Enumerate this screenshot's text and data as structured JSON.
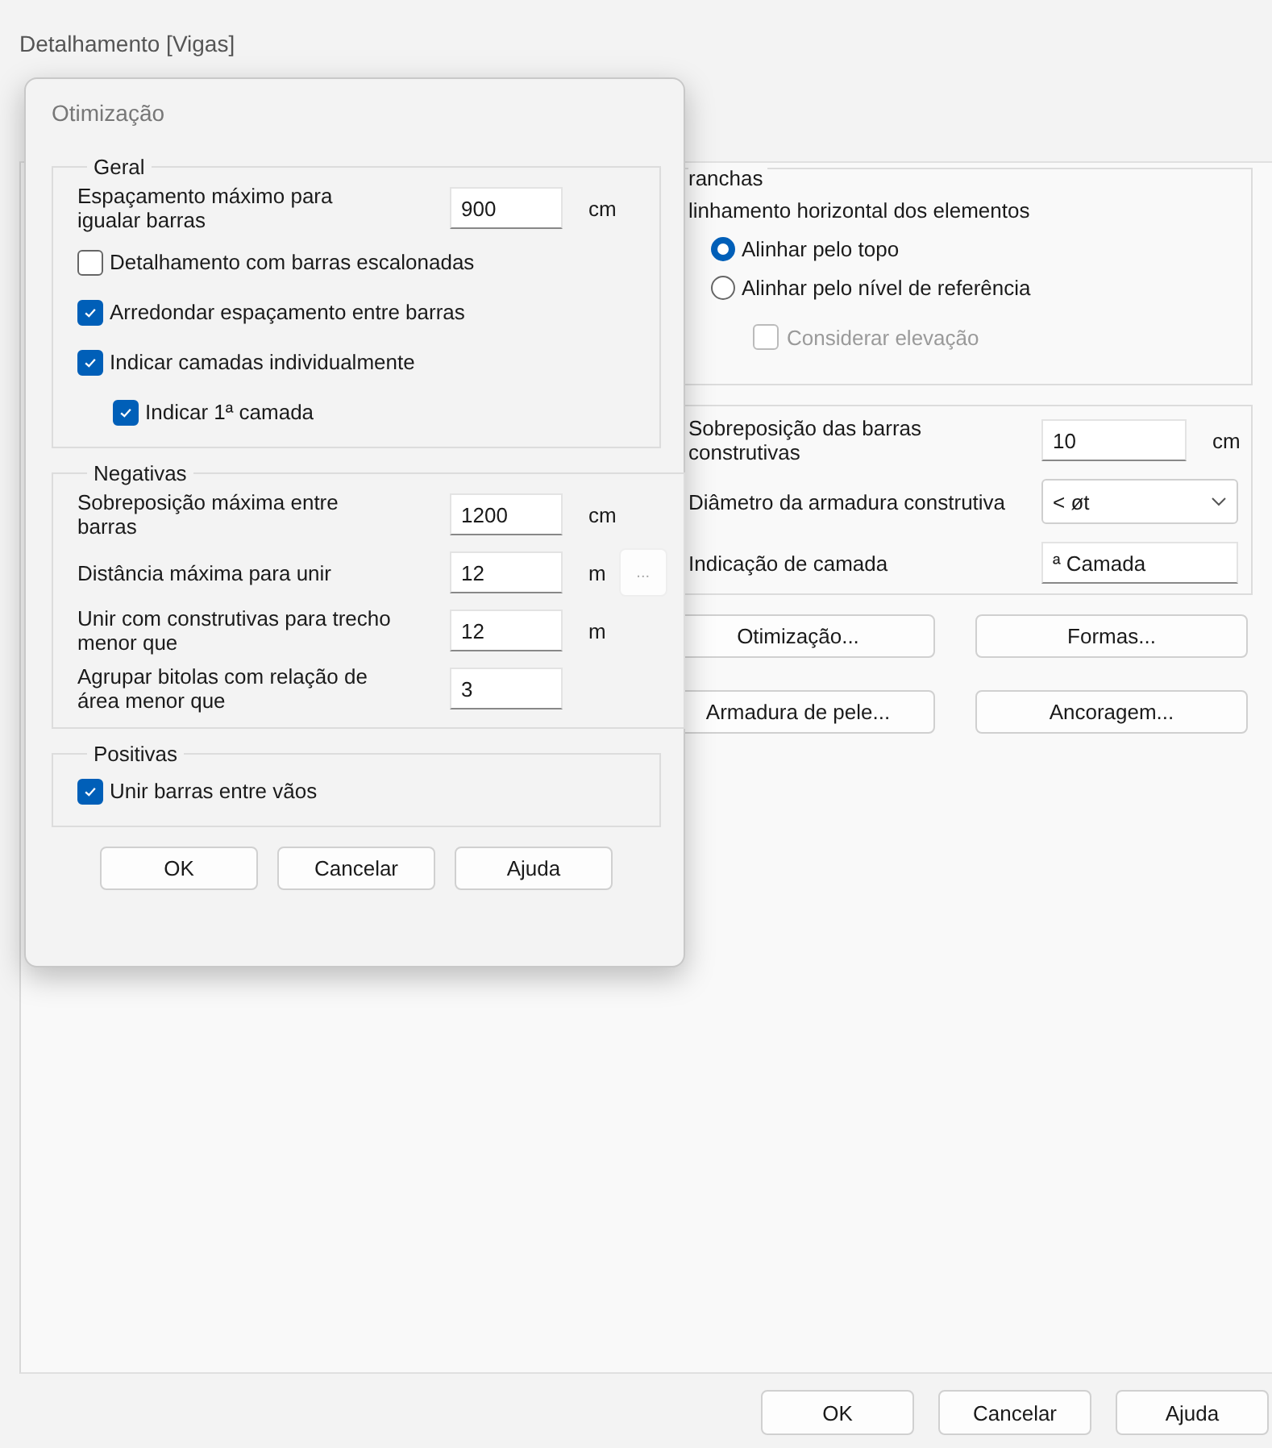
{
  "background_window": {
    "title": "Detalhamento [Vigas]",
    "pranchas_group": {
      "title": "ranchas",
      "label": "linhamento horizontal dos elementos",
      "radios": [
        {
          "label": "Alinhar pelo topo",
          "selected": true
        },
        {
          "label": "Alinhar pelo nível de referência",
          "selected": false
        }
      ],
      "sub_checkbox": {
        "label": "Considerar elevação",
        "checked": false,
        "disabled": true
      }
    },
    "fields": [
      {
        "kind": "input",
        "label": "Sobreposição das barras construtivas",
        "value": "10",
        "unit": "cm"
      },
      {
        "kind": "dropdown",
        "label": "Diâmetro da armadura construtiva",
        "value": "< øt"
      },
      {
        "kind": "input",
        "label": "Indicação de camada",
        "value": "ª Camada"
      }
    ],
    "buttons": [
      "Otimização...",
      "Formas...",
      "Armadura de pele...",
      "Ancoragem..."
    ],
    "footer_buttons": [
      "OK",
      "Cancelar",
      "Ajuda"
    ]
  },
  "dialog": {
    "title": "Otimização",
    "groups": [
      {
        "title": "Geral",
        "items": [
          {
            "kind": "field",
            "label": "Espaçamento máximo para igualar barras",
            "value": "900",
            "unit": "cm"
          },
          {
            "kind": "checkbox",
            "label": "Detalhamento com barras escalonadas",
            "checked": false
          },
          {
            "kind": "checkbox",
            "label": "Arredondar espaçamento entre barras",
            "checked": true
          },
          {
            "kind": "checkbox",
            "label": "Indicar camadas individualmente",
            "checked": true,
            "children": [
              {
                "kind": "checkbox",
                "label": "Indicar 1ª camada",
                "checked": true
              }
            ]
          }
        ]
      },
      {
        "title": "Negativas",
        "items": [
          {
            "kind": "field",
            "label": "Sobreposição máxima entre barras",
            "value": "1200",
            "unit": "cm"
          },
          {
            "kind": "field",
            "label": "Distância máxima para unir",
            "value": "12",
            "unit": "m",
            "extra_button": "..."
          },
          {
            "kind": "field",
            "label": "Unir com construtivas para trecho menor que",
            "value": "12",
            "unit": "m"
          },
          {
            "kind": "field",
            "label": "Agrupar bitolas com relação de área menor que",
            "value": "3"
          }
        ]
      },
      {
        "title": "Positivas",
        "items": [
          {
            "kind": "checkbox",
            "label": "Unir barras entre vãos",
            "checked": true
          }
        ]
      }
    ],
    "buttons": [
      "OK",
      "Cancelar",
      "Ajuda"
    ]
  }
}
